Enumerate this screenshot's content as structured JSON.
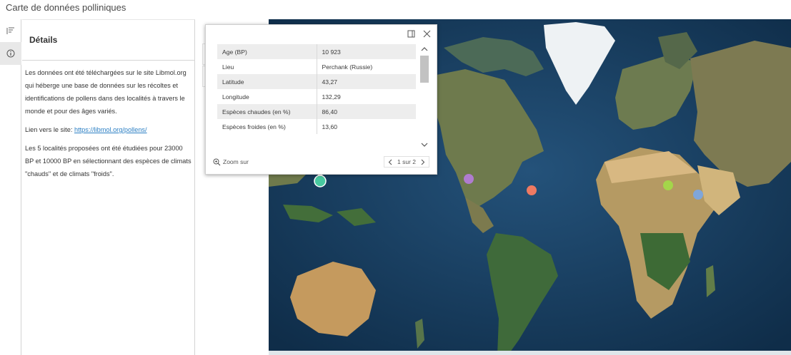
{
  "app": {
    "title": "Carte de données polliniques"
  },
  "details": {
    "header": "Détails",
    "paragraph1": "Les données ont été téléchargées sur le site Libmol.org qui héberge une base de données sur les récoltes et identifications de pollens dans des localités à travers le monde et pour des âges variés.",
    "link_prefix": "Lien vers le site: ",
    "link_text": "https://libmol.org/pollens/",
    "paragraph3": "Les 5 localités proposées ont été étudiées pour 23000 BP et 10000 BP en sélectionnant des espèces de climats \"chauds\" et de climats \"froids\"."
  },
  "popup": {
    "rows": [
      {
        "key": "Age (BP)",
        "value": "10 923"
      },
      {
        "key": "Lieu",
        "value": "Perchank (Russie)"
      },
      {
        "key": "Latitude",
        "value": "43,27"
      },
      {
        "key": "Longitude",
        "value": "132,29"
      },
      {
        "key": "Espèces chaudes (en %)",
        "value": "86,40"
      },
      {
        "key": "Espèces froides (en %)",
        "value": "13,60"
      }
    ],
    "zoom_label": "Zoom sur",
    "pager_label": "1 sur 2"
  },
  "map": {
    "markers": [
      {
        "name": "perchank",
        "color": "#48c9a0",
        "selected": true
      },
      {
        "name": "north-america-west",
        "color": "#b07cd0"
      },
      {
        "name": "north-america-east",
        "color": "#ef7a62"
      },
      {
        "name": "mediterranean",
        "color": "#a4d64a"
      },
      {
        "name": "middle-east",
        "color": "#7fa6da"
      }
    ]
  }
}
